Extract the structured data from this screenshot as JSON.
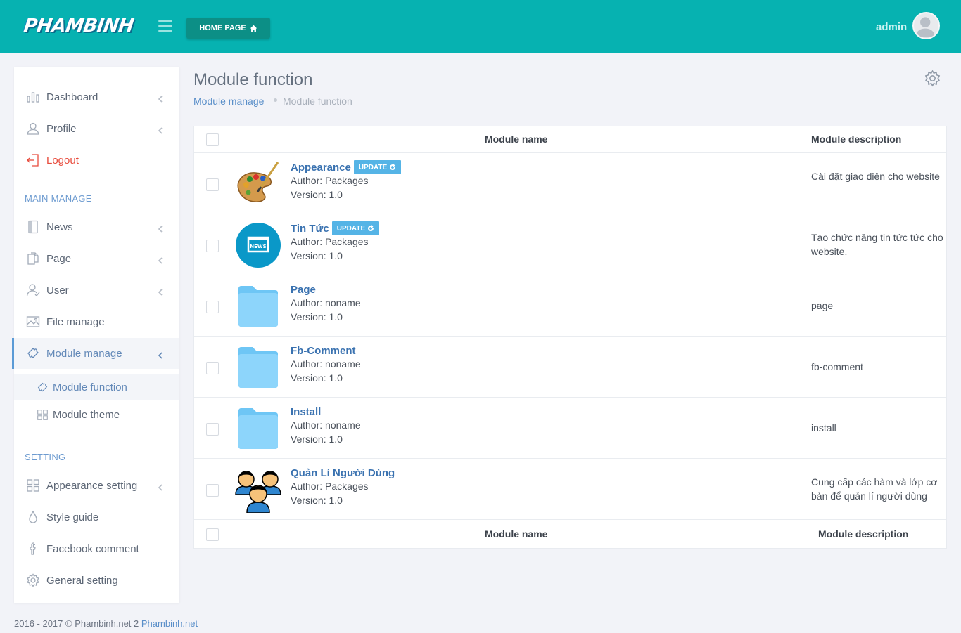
{
  "header": {
    "logo": "PHAMBINH",
    "home_button": "HOME PAGE",
    "user_name": "admin",
    "colors": {
      "bar": "#06b2b1",
      "button": "#0c8f86"
    }
  },
  "sidebar": {
    "top_items": [
      {
        "label": "Dashboard",
        "icon": "bar-chart-icon"
      },
      {
        "label": "Profile",
        "icon": "user-icon"
      },
      {
        "label": "Logout",
        "icon": "logout-icon"
      }
    ],
    "main_manage_title": "MAIN MANAGE",
    "main_items": [
      {
        "label": "News",
        "icon": "notebook-icon"
      },
      {
        "label": "Page",
        "icon": "pages-icon"
      },
      {
        "label": "User",
        "icon": "users-icon"
      },
      {
        "label": "File manage",
        "icon": "image-icon"
      },
      {
        "label": "Module manage",
        "icon": "puzzle-icon"
      }
    ],
    "sub_items": [
      {
        "label": "Module function",
        "icon": "puzzle-icon"
      },
      {
        "label": "Module theme",
        "icon": "grid-icon"
      }
    ],
    "setting_title": "SETTING",
    "setting_items": [
      {
        "label": "Appearance setting",
        "icon": "grid-icon"
      },
      {
        "label": "Style guide",
        "icon": "drop-icon"
      },
      {
        "label": "Facebook comment",
        "icon": "facebook-icon"
      },
      {
        "label": "General setting",
        "icon": "gear-icon"
      }
    ]
  },
  "page": {
    "title": "Module function",
    "breadcrumb": {
      "parent": "Module manage",
      "current": "Module function"
    }
  },
  "table": {
    "col_name": "Module name",
    "col_desc": "Module description",
    "update_label": "UPDATE",
    "rows": [
      {
        "name": "Appearance",
        "author": "Author: Packages",
        "version": "Version: 1.0",
        "desc": "Cài đặt giao diện cho website",
        "icon": "palette-icon",
        "update": true
      },
      {
        "name": "Tin Tức",
        "author": "Author: Packages",
        "version": "Version: 1.0",
        "desc": "Tạo chức năng tin tức tức cho website.",
        "icon": "news-icon",
        "update": true
      },
      {
        "name": "Page",
        "author": "Author: noname",
        "version": "Version: 1.0",
        "desc": "page",
        "icon": "folder-icon",
        "update": false
      },
      {
        "name": "Fb-Comment",
        "author": "Author: noname",
        "version": "Version: 1.0",
        "desc": "fb-comment",
        "icon": "folder-icon",
        "update": false
      },
      {
        "name": "Install",
        "author": "Author: noname",
        "version": "Version: 1.0",
        "desc": "install",
        "icon": "folder-icon",
        "update": false
      },
      {
        "name": "Quản Lí Người Dùng",
        "author": "Author: Packages",
        "version": "Version: 1.0",
        "desc": "Cung cấp các hàm và lớp cơ bản để quản lí người dùng",
        "icon": "users-group-icon",
        "update": false
      }
    ]
  },
  "footer": {
    "text": "2016 - 2017 © Phambinh.net 2 ",
    "link": "Phambinh.net"
  }
}
